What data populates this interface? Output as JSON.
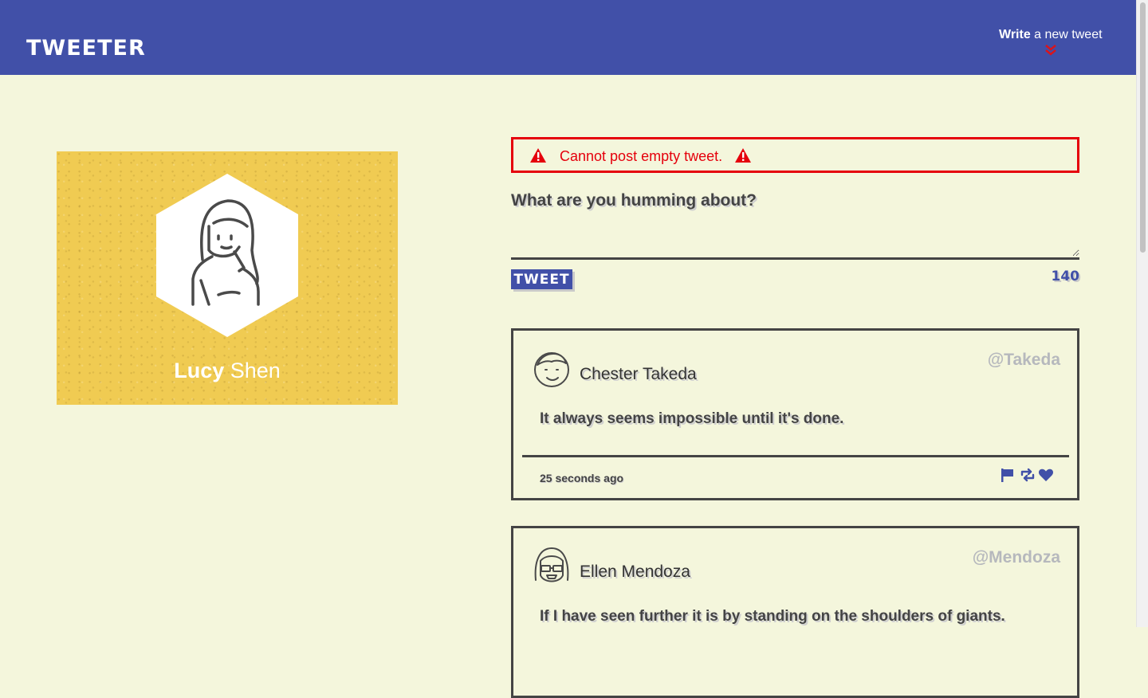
{
  "header": {
    "brand": "TWEETER",
    "compose_toggle": {
      "bold": "Write",
      "rest": " a new tweet"
    },
    "icon": "double-chevron-down-icon"
  },
  "profile": {
    "first_name": "Lucy",
    "last_name": " Shen",
    "avatar_icon": "girl-avatar-icon",
    "background_color": "#f0cb52"
  },
  "error": {
    "message": "Cannot post empty tweet.",
    "icon": "warning-icon",
    "color": "#e5000c"
  },
  "compose": {
    "prompt": "What are you humming about?",
    "value": "",
    "button_label": "TWEET",
    "counter": "140"
  },
  "tweets": [
    {
      "name": "Chester Takeda",
      "handle": "@Takeda",
      "text": "It always seems impossible until it's done.",
      "time": "25 seconds ago",
      "avatar_icon": "boy-avatar-icon"
    },
    {
      "name": "Ellen Mendoza",
      "handle": "@Mendoza",
      "text": "If I have seen further it is by standing on the shoulders of giants.",
      "avatar_icon": "glasses-avatar-icon"
    }
  ],
  "tweet_actions": [
    "flag-icon",
    "retweet-icon",
    "heart-icon"
  ],
  "colors": {
    "accent": "#4150a8",
    "background": "#f4f6dc",
    "text": "#444444"
  }
}
